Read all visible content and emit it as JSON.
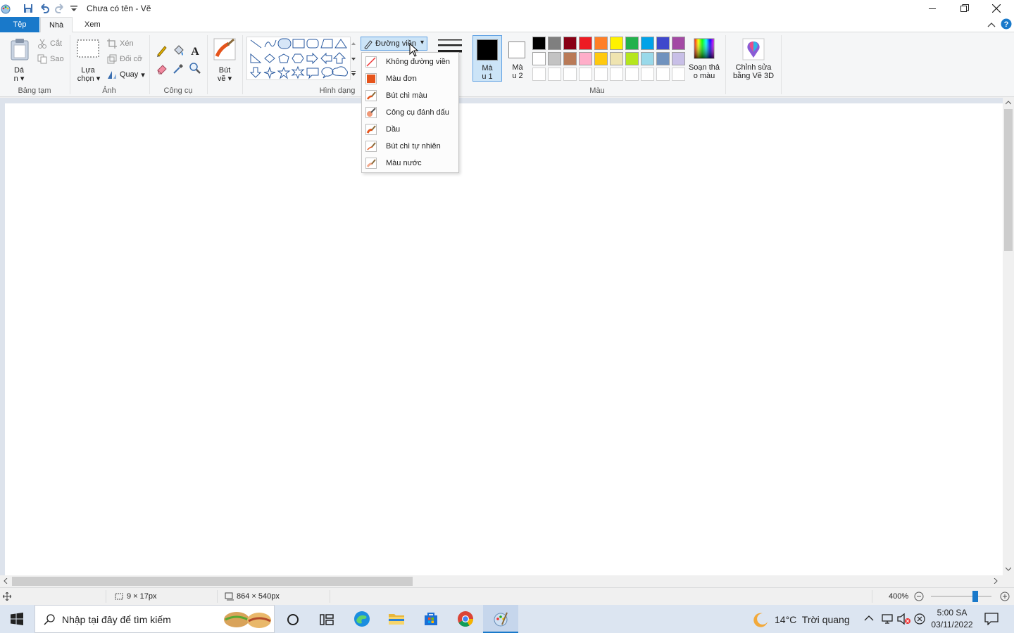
{
  "window": {
    "title": "Chưa có tên - Vẽ"
  },
  "tabs": {
    "file": "Tệp",
    "home": "Nhà",
    "view": "Xem"
  },
  "clipboard": {
    "paste_line1": "Dá",
    "paste_line2": "n",
    "cut": "Cắt",
    "copy": "Sao",
    "group": "Bảng tạm"
  },
  "image": {
    "select_line1": "Lựa",
    "select_line2": "chọn",
    "crop": "Xén",
    "resize": "Đổi cỡ",
    "rotate": "Quay",
    "group": "Ảnh"
  },
  "tools": {
    "group": "Công cụ"
  },
  "brushes": {
    "line1": "Bút",
    "line2": "vẽ"
  },
  "shapes": {
    "group": "Hình dạng",
    "outline_button": "Đường viền"
  },
  "colors": {
    "color1_line1": "Mà",
    "color1_line2": "u 1",
    "color2_line1": "Mà",
    "color2_line2": "u 2",
    "edit_line1": "Soạn thả",
    "edit_line2": "o màu",
    "paint3d_line1": "Chỉnh sửa",
    "paint3d_line2": "bằng Vẽ 3D",
    "group": "Màu",
    "color1_value": "#000000",
    "color2_value": "#ffffff",
    "palette_row1": [
      "#000000",
      "#7f7f7f",
      "#880015",
      "#ed1c24",
      "#ff7f27",
      "#fff200",
      "#22b14c",
      "#00a2e8",
      "#3f48cc",
      "#a349a4"
    ],
    "palette_row2": [
      "#ffffff",
      "#c3c3c3",
      "#b97a57",
      "#ffaec9",
      "#ffc90e",
      "#efe4b0",
      "#b5e61d",
      "#99d9ea",
      "#7092be",
      "#c8bfe7"
    ]
  },
  "outline_menu": {
    "items": [
      {
        "label": "Không đường viền",
        "icon": "no-outline-icon"
      },
      {
        "label": "Màu đơn",
        "icon": "solid-color-icon"
      },
      {
        "label": "Bút chì màu",
        "icon": "crayon-icon"
      },
      {
        "label": "Công cụ đánh dấu",
        "icon": "marker-icon"
      },
      {
        "label": "Dầu",
        "icon": "oil-icon"
      },
      {
        "label": "Bút chì tự nhiên",
        "icon": "natural-pencil-icon"
      },
      {
        "label": "Màu nước",
        "icon": "watercolor-icon"
      }
    ]
  },
  "status": {
    "cursor": "",
    "selection": "9 × 17px",
    "canvas_size": "864 × 540px",
    "zoom": "400%",
    "zoom_level": 0.75
  },
  "taskbar": {
    "search_placeholder": "Nhập tại đây để tìm kiếm",
    "weather": "14°C  Trời quang",
    "time": "5:00 SA",
    "date": "03/11/2022"
  }
}
